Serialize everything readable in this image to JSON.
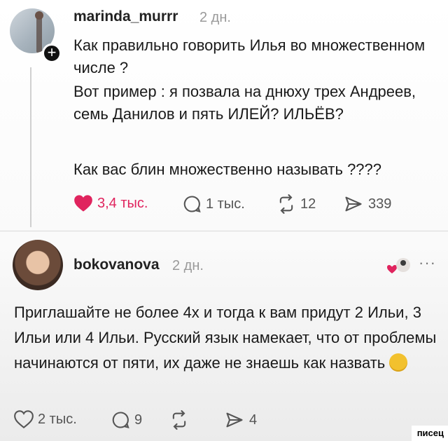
{
  "post": {
    "username": "marinda_murrr",
    "time": "2 дн.",
    "lines": [
      "Как правильно говорить Илья во множественном числе ?",
      "Вот пример : я позвала на днюху трех Андреев, семь Данилов и пять ИЛЕЙ? ИЛЬЁВ?",
      "Как вас блин множественно называть ????"
    ],
    "actions": {
      "likes": "3,4 тыс.",
      "replies": "1 тыс.",
      "reposts": "12",
      "shares": "339"
    }
  },
  "reply": {
    "username": "bokovanova",
    "time": "2 дн.",
    "text": "Приглашайте не более 4х и тогда к вам придут 2 Ильи, 3 Ильи или 4 Ильи. Русский язык намекает, что от проблемы начинаются от пяти, их даже не знаешь как назвать",
    "more": "···",
    "actions": {
      "likes": "2 тыс.",
      "replies": "9",
      "reposts": "",
      "shares": "4"
    }
  },
  "watermark": "писец",
  "colors": {
    "like_active": "#e0245e",
    "muted": "#9a9a9a"
  }
}
